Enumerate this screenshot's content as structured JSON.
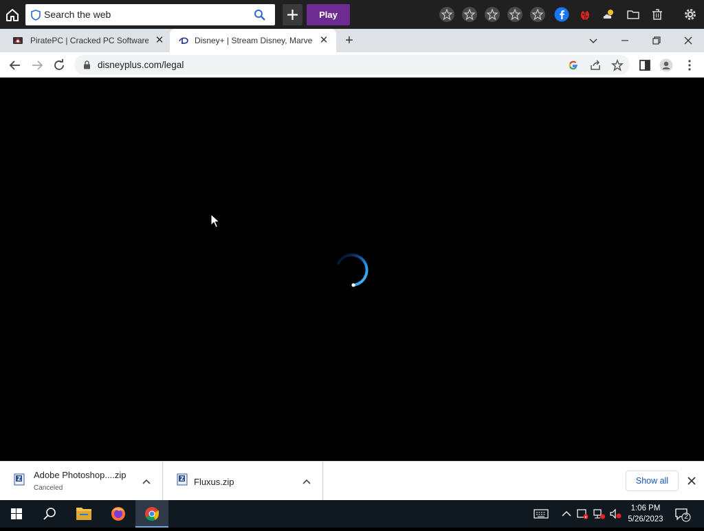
{
  "toolbar": {
    "search_placeholder": "Search the web",
    "play_label": "Play",
    "facebook_color": "#1877f2",
    "play_color": "#6c2c91"
  },
  "tabs": [
    {
      "title": "PiratePC | Cracked PC Software F",
      "favicon": "piratepc-icon",
      "active": false
    },
    {
      "title": "Disney+ | Stream Disney, Marvel,",
      "favicon": "disney-icon",
      "active": true
    }
  ],
  "address": {
    "url": "disneyplus.com/legal"
  },
  "downloads": {
    "items": [
      {
        "name": "Adobe Photoshop....zip",
        "status": "Canceled"
      },
      {
        "name": "Fluxus.zip",
        "status": ""
      }
    ],
    "show_all_label": "Show all"
  },
  "taskbar": {
    "time": "1:06 PM",
    "date": "5/26/2023",
    "notification_count": "2"
  }
}
